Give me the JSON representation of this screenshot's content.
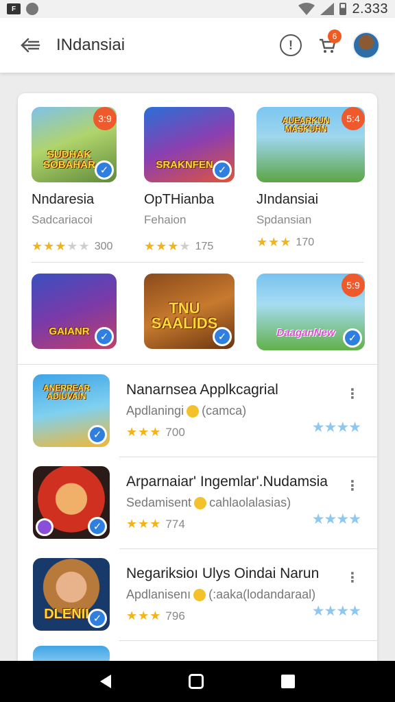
{
  "status_bar": {
    "left_icon_label": "F",
    "time": "2.333",
    "icons": [
      "notification-icon",
      "clock-icon",
      "wifi-icon",
      "signal-icon",
      "battery-icon"
    ]
  },
  "app_bar": {
    "title": "INdansiai",
    "cart_badge": "6",
    "icons": [
      "back-arrow-icon",
      "info-icon",
      "cart-icon",
      "avatar"
    ]
  },
  "grid": {
    "row1": [
      {
        "title": "Nndaresia",
        "subtitle": "Sadcariacoi",
        "rating_count": "300",
        "stars": 3,
        "badge": "3:9",
        "caption": "SUDHAK SOBAHAR",
        "verified": true
      },
      {
        "title": "OpTHianba",
        "subtitle": "Fehaion",
        "rating_count": "175",
        "stars": 3,
        "badge": "",
        "caption": "SRAKNFEN",
        "verified": true
      },
      {
        "title": "JIndansiai",
        "subtitle": "Spdansian",
        "rating_count": "170",
        "stars": 3,
        "badge": "5:4",
        "caption": "AUEARKUN MASKUHN",
        "verified": false
      }
    ],
    "row2": [
      {
        "caption": "GAIANR",
        "badge": "",
        "verified": true
      },
      {
        "caption": "TNU SAALIDS",
        "badge": "",
        "verified": true
      },
      {
        "caption": "DaaganNew",
        "badge": "5:9",
        "verified": true
      }
    ]
  },
  "list": [
    {
      "title": "Nanarnsea Applkcagrial",
      "subtitle_left": "Apdlaningi",
      "subtitle_right": "(camca)",
      "rating_count": "700",
      "thumb_caption": "ANERREAR ADIUVAIN",
      "badge_left": false
    },
    {
      "title": "Arparnaiar' Ingemlar'.Nudamsia",
      "subtitle_left": "Sedamisent",
      "subtitle_right": "cahlaolalasias)",
      "rating_count": "774",
      "thumb_caption": "",
      "badge_left": true
    },
    {
      "title": "Negariksioı Ulys Oindai Narun",
      "subtitle_left": "Apdlanisenı",
      "subtitle_right": "(:aaka(lodandaraal)",
      "rating_count": "796",
      "thumb_caption": "DLENII",
      "badge_left": false
    }
  ],
  "nav": {
    "icons": [
      "nav-back-icon",
      "nav-home-icon",
      "nav-recent-icon"
    ]
  },
  "colors": {
    "accent_blue": "#2f7fe0",
    "badge_orange": "#ef5a2c",
    "star_gold": "#f3b31a",
    "star_light_blue": "#8ec8ef"
  }
}
